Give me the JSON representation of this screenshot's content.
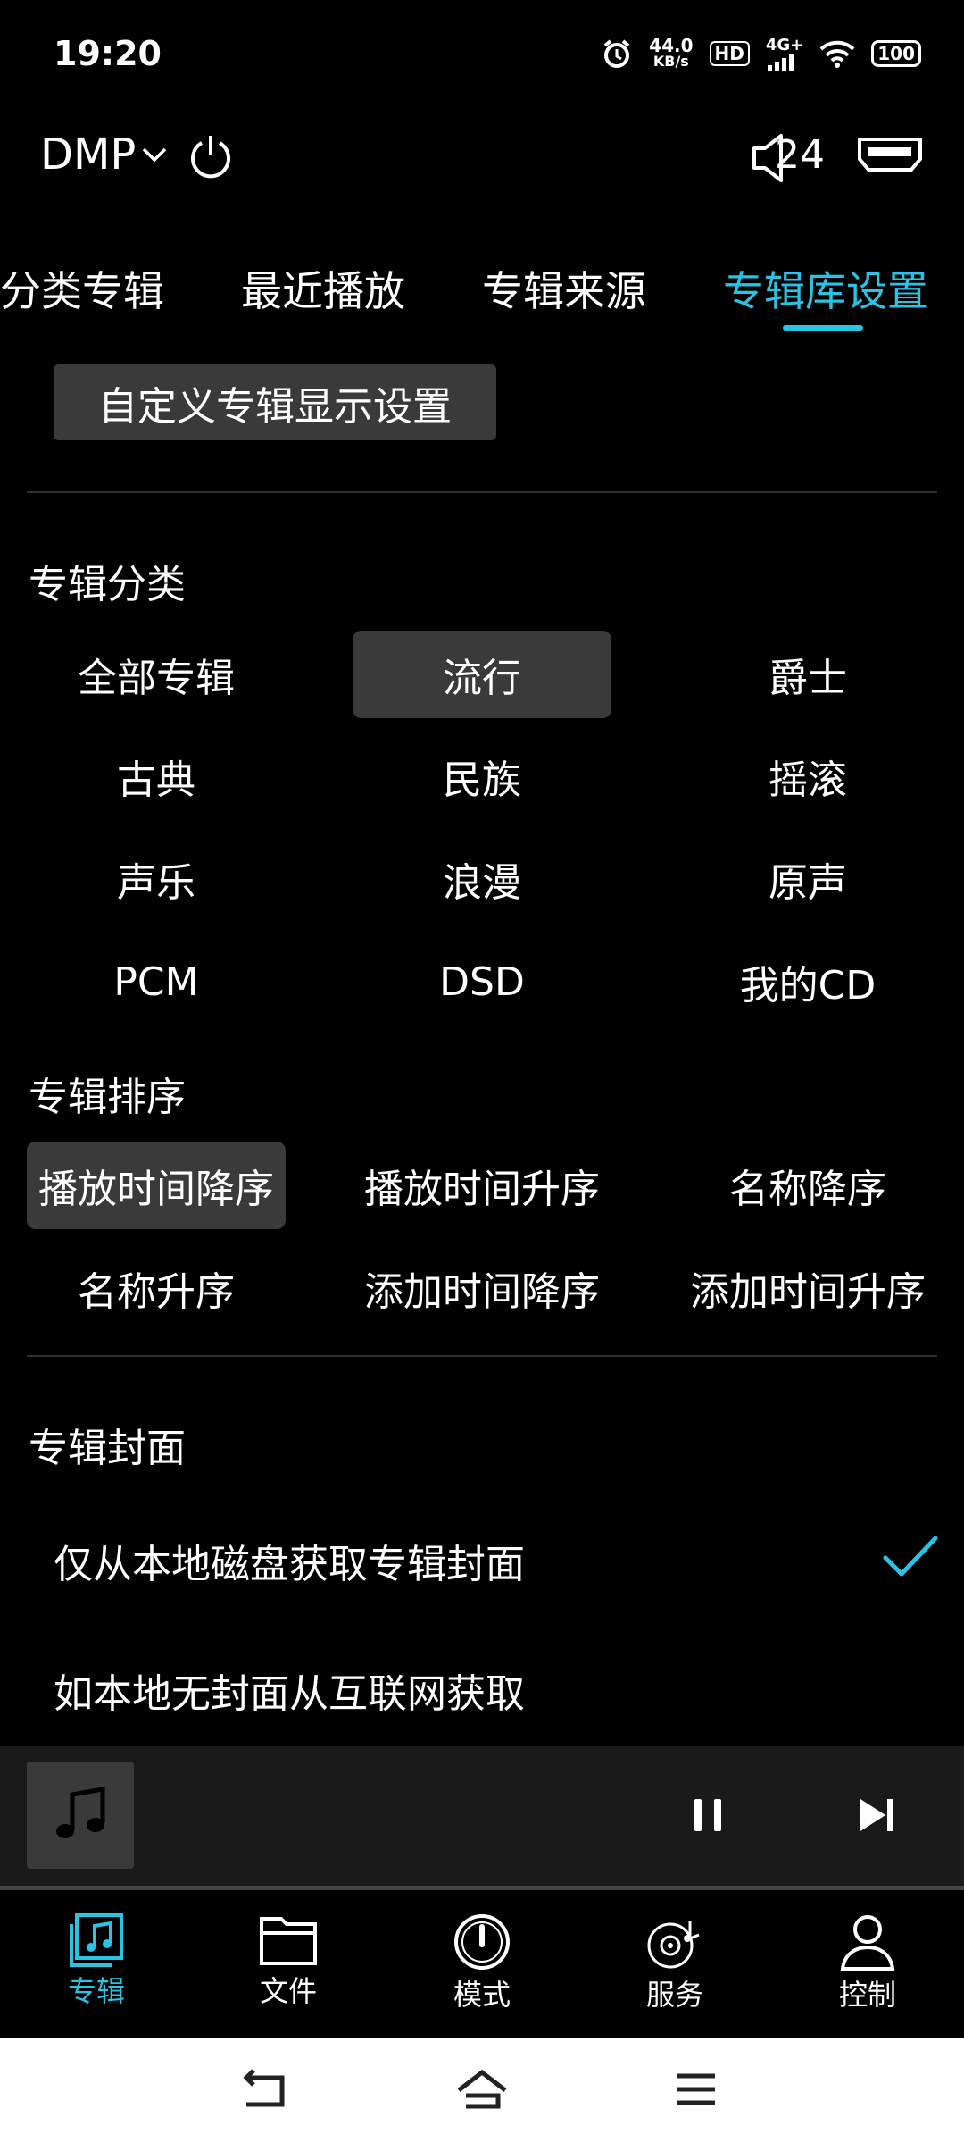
{
  "status_bar": {
    "time": "19:20",
    "net_speed_value": "44.0",
    "net_speed_unit": "KB/s",
    "hd_label": "HD",
    "network": "4G+",
    "battery": "100"
  },
  "header": {
    "device": "DMP",
    "volume": "24"
  },
  "tabs": [
    {
      "label": "分类专辑",
      "active": false
    },
    {
      "label": "最近播放",
      "active": false
    },
    {
      "label": "专辑来源",
      "active": false
    },
    {
      "label": "专辑库设置",
      "active": true
    }
  ],
  "custom_button_label": "自定义专辑显示设置",
  "category": {
    "title": "专辑分类",
    "items": [
      "全部专辑",
      "流行",
      "爵士",
      "古典",
      "民族",
      "摇滚",
      "声乐",
      "浪漫",
      "原声",
      "PCM",
      "DSD",
      "我的CD"
    ],
    "selected": "流行"
  },
  "sort": {
    "title": "专辑排序",
    "items": [
      "播放时间降序",
      "播放时间升序",
      "名称降序",
      "名称升序",
      "添加时间降序",
      "添加时间升序"
    ],
    "selected": "播放时间降序"
  },
  "cover": {
    "title": "专辑封面",
    "options": [
      "仅从本地磁盘获取专辑封面",
      "如本地无封面从互联网获取"
    ],
    "selected": "仅从本地磁盘获取专辑封面"
  },
  "bottom_nav": [
    {
      "label": "专辑",
      "icon": "album-icon",
      "active": true
    },
    {
      "label": "文件",
      "icon": "folder-icon",
      "active": false
    },
    {
      "label": "模式",
      "icon": "mode-knob-icon",
      "active": false
    },
    {
      "label": "服务",
      "icon": "service-disc-icon",
      "active": false
    },
    {
      "label": "控制",
      "icon": "user-icon",
      "active": false
    }
  ],
  "accent_color": "#29c3e6"
}
